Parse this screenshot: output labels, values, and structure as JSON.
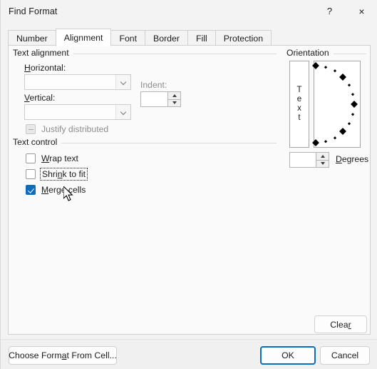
{
  "window": {
    "title": "Find Format",
    "help_button": "?",
    "close_button": "×"
  },
  "tabs": [
    {
      "label": "Number",
      "active": false
    },
    {
      "label": "Alignment",
      "active": true
    },
    {
      "label": "Font",
      "active": false
    },
    {
      "label": "Border",
      "active": false
    },
    {
      "label": "Fill",
      "active": false
    },
    {
      "label": "Protection",
      "active": false
    }
  ],
  "text_alignment": {
    "group_label": "Text alignment",
    "horizontal": {
      "label": "Horizontal:",
      "accelerator": "H",
      "value": "",
      "placeholder": ""
    },
    "vertical": {
      "label": "Vertical:",
      "accelerator": "V",
      "value": "",
      "placeholder": ""
    },
    "indent": {
      "label": "Indent:",
      "value": "",
      "disabled": true
    },
    "justify_distributed": {
      "label": "Justify distributed",
      "state": "indeterminate",
      "disabled": true
    }
  },
  "text_control": {
    "group_label": "Text control",
    "items": [
      {
        "label": "Wrap text",
        "accel": "W",
        "checked": false,
        "focused": false
      },
      {
        "label": "Shrink to fit",
        "accel": "n",
        "checked": false,
        "focused": true
      },
      {
        "label": "Merge cells",
        "accel": "M",
        "checked": true,
        "focused": false
      }
    ]
  },
  "orientation": {
    "group_label": "Orientation",
    "text_label": "Text",
    "text_letters": [
      "T",
      "e",
      "x",
      "t"
    ],
    "degrees": {
      "value": "",
      "label": "Degrees",
      "accelerator": "D"
    },
    "dial_markers": [
      {
        "angle": 90,
        "size": "big"
      },
      {
        "angle": 75,
        "size": "small"
      },
      {
        "angle": 60,
        "size": "small"
      },
      {
        "angle": 45,
        "size": "big"
      },
      {
        "angle": 30,
        "size": "small"
      },
      {
        "angle": 15,
        "size": "small"
      },
      {
        "angle": 0,
        "size": "big"
      },
      {
        "angle": -15,
        "size": "small"
      },
      {
        "angle": -30,
        "size": "small"
      },
      {
        "angle": -45,
        "size": "big"
      },
      {
        "angle": -60,
        "size": "small"
      },
      {
        "angle": -75,
        "size": "small"
      },
      {
        "angle": -90,
        "size": "big"
      }
    ]
  },
  "buttons": {
    "clear": {
      "label": "Clear",
      "accel": "r"
    },
    "choose": {
      "label": "Choose Format From Cell...",
      "accel": "a"
    },
    "ok": {
      "label": "OK",
      "default": true
    },
    "cancel": {
      "label": "Cancel"
    }
  },
  "colors": {
    "accent": "#0f6cbd",
    "window_bg": "#f3f3f3",
    "page_bg": "#fafafa",
    "footer_bg": "#f0f0f0",
    "border": "#d0d0d0",
    "disabled_text": "#8d8d8d"
  }
}
